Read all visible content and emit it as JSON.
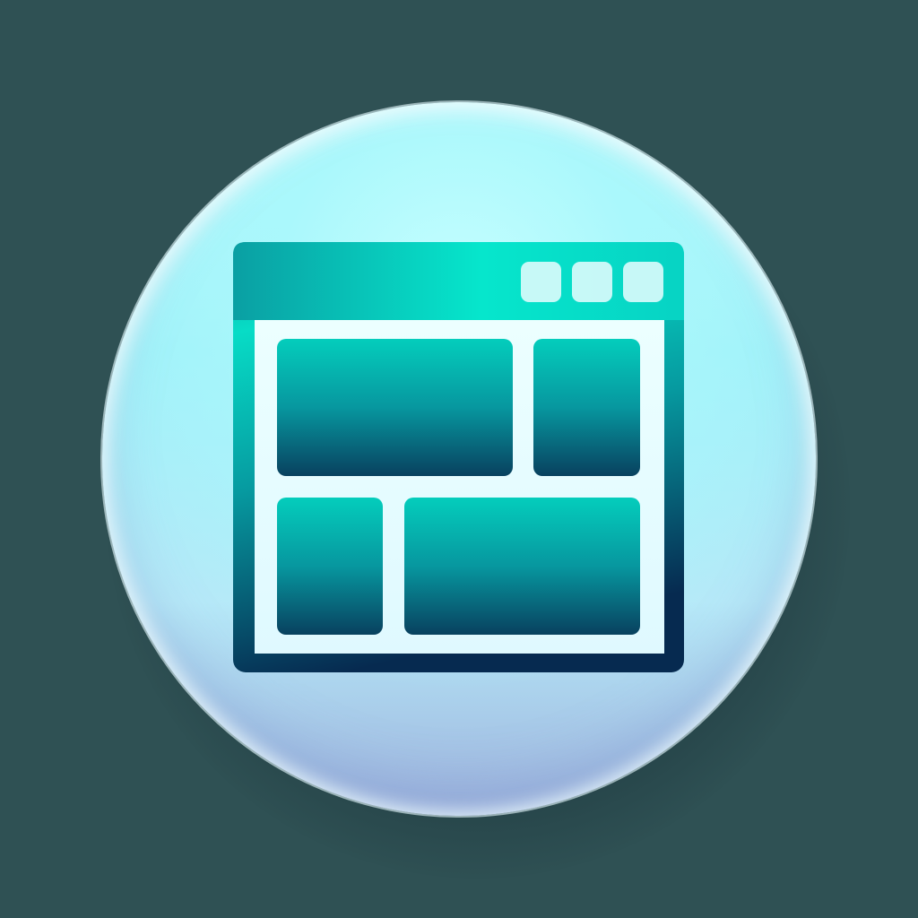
{
  "icon": {
    "name": "window-layout-icon",
    "colors": {
      "background": "#2f5154",
      "orb_light": "#b4fbfb",
      "orb_bottom": "#9db3dd",
      "accent_top": "#06e2c8",
      "accent_bottom": "#06284e"
    },
    "window_controls": 3,
    "panels": 4
  }
}
